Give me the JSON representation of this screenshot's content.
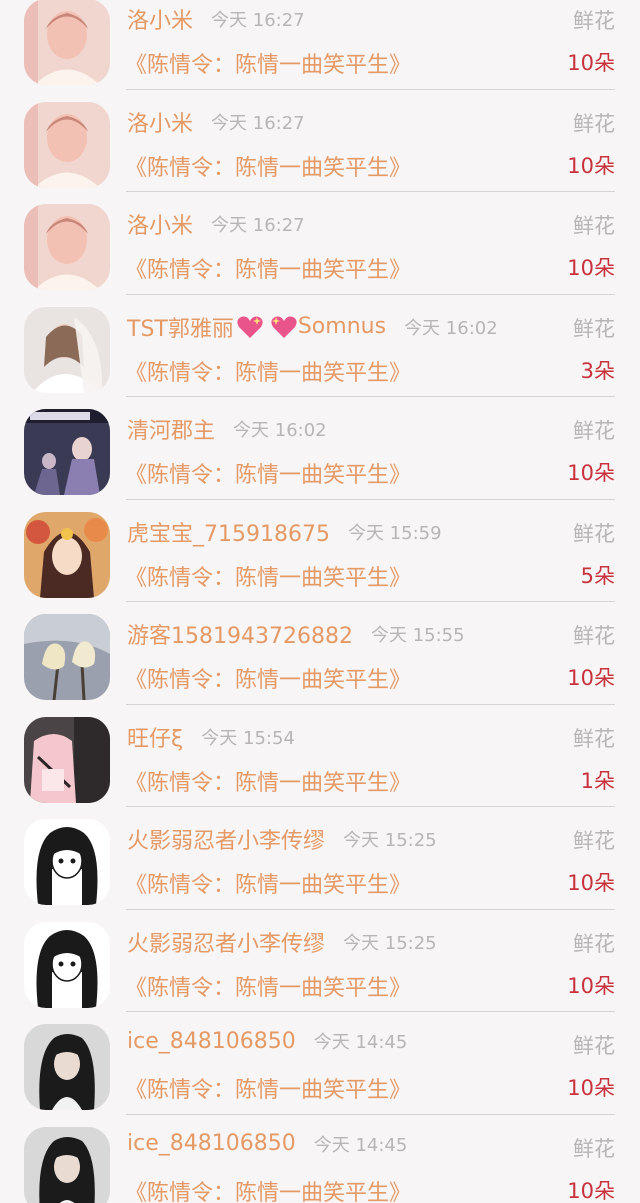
{
  "records": [
    {
      "name": "洛小米",
      "name_suffix": "",
      "time": "今天 16:27",
      "gift_type": "鲜花",
      "work": "《陈情令：陈情一曲笑平生》",
      "count": "10朵",
      "avatar": "pink-portrait-avatar"
    },
    {
      "name": "洛小米",
      "name_suffix": "",
      "time": "今天 16:27",
      "gift_type": "鲜花",
      "work": "《陈情令：陈情一曲笑平生》",
      "count": "10朵",
      "avatar": "pink-portrait-avatar"
    },
    {
      "name": "洛小米",
      "name_suffix": "",
      "time": "今天 16:27",
      "gift_type": "鲜花",
      "work": "《陈情令：陈情一曲笑平生》",
      "count": "10朵",
      "avatar": "pink-portrait-avatar"
    },
    {
      "name": "TST郭雅丽",
      "name_suffix": " Somnus",
      "time": "今天 16:02",
      "gift_type": "鲜花",
      "work": "《陈情令：陈情一曲笑平生》",
      "count": "3朵",
      "avatar": "bride-avatar"
    },
    {
      "name": "清河郡主",
      "name_suffix": "",
      "time": "今天 16:02",
      "gift_type": "鲜花",
      "work": "《陈情令：陈情一曲笑平生》",
      "count": "10朵",
      "avatar": "game-art-avatar"
    },
    {
      "name": "虎宝宝_715918675",
      "name_suffix": "",
      "time": "今天 15:59",
      "gift_type": "鲜花",
      "work": "《陈情令：陈情一曲笑平生》",
      "count": "5朵",
      "avatar": "illustrated-girl-avatar"
    },
    {
      "name": "游客1581943726882",
      "name_suffix": "",
      "time": "今天 15:55",
      "gift_type": "鲜花",
      "work": "《陈情令：陈情一曲笑平生》",
      "count": "10朵",
      "avatar": "magnolia-avatar"
    },
    {
      "name": "旺仔ξ",
      "name_suffix": "",
      "time": "今天 15:54",
      "gift_type": "鲜花",
      "work": "《陈情令：陈情一曲笑平生》",
      "count": "1朵",
      "avatar": "pink-sweater-avatar"
    },
    {
      "name": "火影弱忍者小李传缪",
      "name_suffix": "",
      "time": "今天 15:25",
      "gift_type": "鲜花",
      "work": "《陈情令：陈情一曲笑平生》",
      "count": "10朵",
      "avatar": "manga-girl-avatar"
    },
    {
      "name": "火影弱忍者小李传缪",
      "name_suffix": "",
      "time": "今天 15:25",
      "gift_type": "鲜花",
      "work": "《陈情令：陈情一曲笑平生》",
      "count": "10朵",
      "avatar": "manga-girl-avatar"
    },
    {
      "name": "ice_848106850",
      "name_suffix": "",
      "time": "今天 14:45",
      "gift_type": "鲜花",
      "work": "《陈情令：陈情一曲笑平生》",
      "count": "10朵",
      "avatar": "costume-portrait-avatar"
    },
    {
      "name": "ice_848106850",
      "name_suffix": "",
      "time": "今天 14:45",
      "gift_type": "鲜花",
      "work": "《陈情令：陈情一曲笑平生》",
      "count": "10朵",
      "avatar": "costume-portrait-avatar"
    }
  ]
}
